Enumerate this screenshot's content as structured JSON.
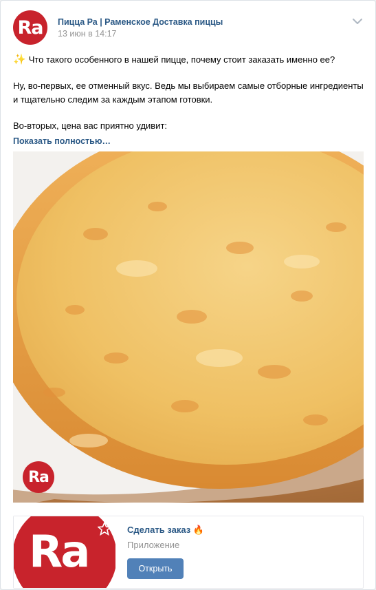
{
  "post": {
    "author": "Пицца Ра | Раменское Доставка пиццы",
    "date": "13 июн в 14:17",
    "avatar_text": "Ra",
    "sparkle": "✨",
    "line1": "Что такого особенного в нашей пицце, почему стоит заказать именно ее?",
    "para2": "Ну, во-первых, ее отменный вкус. Ведь мы выбираем самые отборные ингредиенты и тщательно следим за каждым этапом готовки.",
    "para3": "Во-вторых, цена вас приятно удивит:",
    "show_more": "Показать полностью…",
    "photo_logo_text": "Ra"
  },
  "app": {
    "title": "Сделать заказ",
    "fire_emoji": "🔥",
    "subtitle": "Приложение",
    "button": "Открыть",
    "logo_text": "Ra"
  },
  "colors": {
    "brand_red": "#c8232c",
    "link_blue": "#2a5885",
    "button_blue": "#5181b8",
    "muted": "#939393"
  },
  "icons": [
    "chevron-down-icon",
    "sparkles-icon",
    "fire-icon",
    "star-icon"
  ]
}
